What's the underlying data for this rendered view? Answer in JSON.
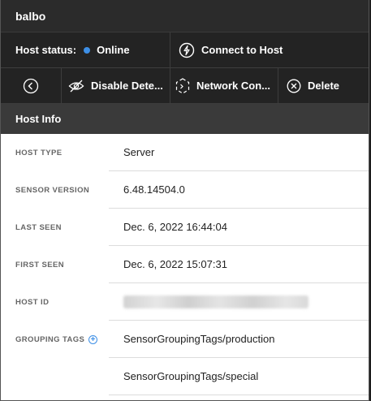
{
  "window": {
    "title": "balbo"
  },
  "host_status": {
    "label": "Host status:",
    "value": "Online",
    "dot_color": "#3d8fe6"
  },
  "actions": {
    "connect_label": "Connect to Host",
    "disable_label": "Disable Dete...",
    "network_label": "Network Con...",
    "delete_label": "Delete"
  },
  "section": {
    "title": "Host Info"
  },
  "info": {
    "host_type": {
      "label": "HOST TYPE",
      "value": "Server"
    },
    "sensor_version": {
      "label": "SENSOR VERSION",
      "value": "6.48.14504.0"
    },
    "last_seen": {
      "label": "LAST SEEN",
      "value": "Dec. 6, 2022 16:44:04"
    },
    "first_seen": {
      "label": "FIRST SEEN",
      "value": "Dec. 6, 2022 15:07:31"
    },
    "host_id": {
      "label": "HOST ID"
    },
    "grouping_tags": {
      "label": "GROUPING TAGS",
      "values": [
        "SensorGroupingTags/production",
        "SensorGroupingTags/special"
      ]
    }
  },
  "icons": [
    "back-arrow-icon",
    "eye-slash-icon",
    "network-icon",
    "close-circle-icon",
    "power-icon",
    "add-tag-icon"
  ]
}
